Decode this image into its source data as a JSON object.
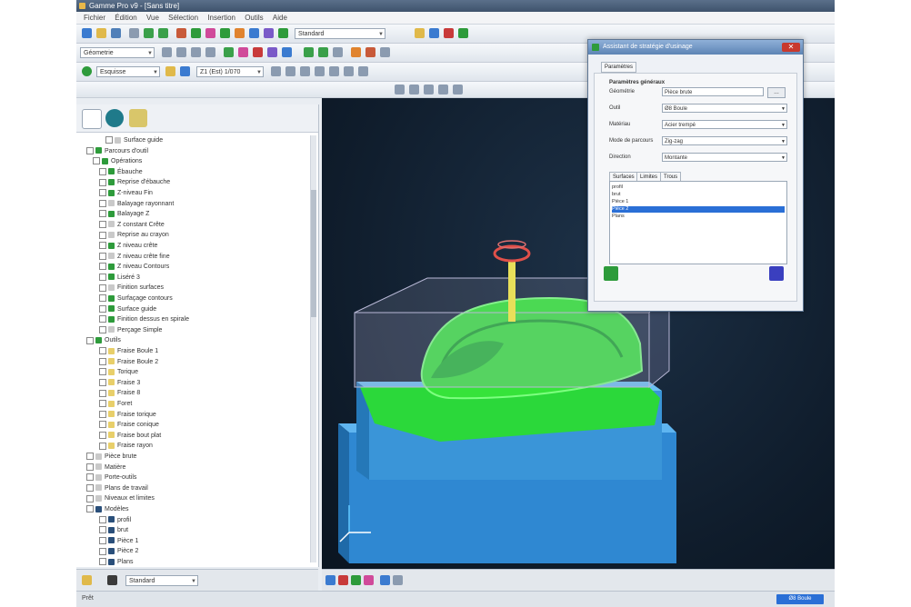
{
  "colors": {
    "viewport_bg": "#0f1c2b",
    "stock_block": "#2f88d2",
    "part_green": "#36e33a",
    "tool_holder": "#e0504a",
    "dialog_title": "#5d84b5",
    "list_selection": "#2a6fd6"
  },
  "window": {
    "title": "Gamme Pro v9 - [Sans titre]",
    "menu": [
      "Fichier",
      "Édition",
      "Vue",
      "Sélection",
      "Insertion",
      "Outils",
      "Aide"
    ]
  },
  "toolbar": {
    "combo1": "Géometrie",
    "combo2": "Standard",
    "combo3": "Z1 (Est) 1/070",
    "combo4": "Esquisse"
  },
  "tree": {
    "rows": [
      {
        "label": "Surface guide",
        "indent": 4,
        "icon": "#c9c9c9"
      },
      {
        "label": "Parcours d'outil",
        "indent": 1,
        "icon": "#2e9b3b"
      },
      {
        "label": "Opérations",
        "indent": 2,
        "icon": "#2e9b3b"
      },
      {
        "label": "Ébauche",
        "indent": 3,
        "icon": "#2e9b3b"
      },
      {
        "label": "Reprise d'ébauche",
        "indent": 3,
        "icon": "#2e9b3b"
      },
      {
        "label": "Z-niveau Fin",
        "indent": 3,
        "icon": "#2e9b3b"
      },
      {
        "label": "Balayage rayonnant",
        "indent": 3,
        "icon": "#c9c9c9"
      },
      {
        "label": "Balayage Z",
        "indent": 3,
        "icon": "#2e9b3b"
      },
      {
        "label": "Z constant Crête",
        "indent": 3,
        "icon": "#c9c9c9"
      },
      {
        "label": "Reprise au crayon",
        "indent": 3,
        "icon": "#c9c9c9"
      },
      {
        "label": "Z niveau crête",
        "indent": 3,
        "icon": "#2e9b3b"
      },
      {
        "label": "Z niveau crête fine",
        "indent": 3,
        "icon": "#c9c9c9"
      },
      {
        "label": "Z niveau Contours",
        "indent": 3,
        "icon": "#2e9b3b"
      },
      {
        "label": "Liséré 3",
        "indent": 3,
        "icon": "#2e9b3b"
      },
      {
        "label": "Finition surfaces",
        "indent": 3,
        "icon": "#c9c9c9"
      },
      {
        "label": "Surfaçage contours",
        "indent": 3,
        "icon": "#2e9b3b"
      },
      {
        "label": "Surface guide",
        "indent": 3,
        "icon": "#2e9b3b"
      },
      {
        "label": "Finition dessus en spirale",
        "indent": 3,
        "icon": "#2e9b3b"
      },
      {
        "label": "Perçage Simple",
        "indent": 3,
        "icon": "#c9c9c9"
      },
      {
        "label": "Outils",
        "indent": 1,
        "icon": "#2e9b3b"
      },
      {
        "label": "Fraise Boule 1",
        "indent": 3,
        "icon": "#e8cf6a"
      },
      {
        "label": "Fraise Boule 2",
        "indent": 3,
        "icon": "#e8cf6a"
      },
      {
        "label": "Torique",
        "indent": 3,
        "icon": "#e8cf6a"
      },
      {
        "label": "Fraise 3",
        "indent": 3,
        "icon": "#e8cf6a"
      },
      {
        "label": "Fraise 8",
        "indent": 3,
        "icon": "#e8cf6a"
      },
      {
        "label": "Foret",
        "indent": 3,
        "icon": "#e8cf6a"
      },
      {
        "label": "Fraise torique",
        "indent": 3,
        "icon": "#e8cf6a"
      },
      {
        "label": "Fraise conique",
        "indent": 3,
        "icon": "#e8cf6a"
      },
      {
        "label": "Fraise bout plat",
        "indent": 3,
        "icon": "#e8cf6a"
      },
      {
        "label": "Fraise rayon",
        "indent": 3,
        "icon": "#e8cf6a"
      },
      {
        "label": "Pièce brute",
        "indent": 1,
        "icon": "#c9c9c9"
      },
      {
        "label": "Matière",
        "indent": 1,
        "icon": "#c9c9c9"
      },
      {
        "label": "Porte-outils",
        "indent": 1,
        "icon": "#c9c9c9"
      },
      {
        "label": "Plans de travail",
        "indent": 1,
        "icon": "#c9c9c9"
      },
      {
        "label": "Niveaux et limites",
        "indent": 1,
        "icon": "#c9c9c9"
      },
      {
        "label": "Modèles",
        "indent": 1,
        "icon": "#2a4f7a"
      },
      {
        "label": "profil",
        "indent": 3,
        "icon": "#2a4f7a"
      },
      {
        "label": "brut",
        "indent": 3,
        "icon": "#2a4f7a"
      },
      {
        "label": "Pièce 1",
        "indent": 3,
        "icon": "#2a4f7a"
      },
      {
        "label": "Pièce 2",
        "indent": 3,
        "icon": "#2a4f7a"
      },
      {
        "label": "Plans",
        "indent": 3,
        "icon": "#2a4f7a"
      }
    ]
  },
  "dialog": {
    "title": "Assistant de stratégie d'usinage",
    "close": "✕",
    "tab_general": "Paramètres",
    "section_title": "Paramètres généraux",
    "label_geometry": "Géométrie",
    "geometry_value": "Pièce brute",
    "row_labels": [
      "Outil",
      "Matériau",
      "Mode de parcours",
      "Direction"
    ],
    "row_values": [
      "Ø8 Boule",
      "Acier trempé",
      "Zig-zag",
      "Montante"
    ],
    "list_tabs": [
      "Surfaces",
      "Limites",
      "Trous"
    ],
    "list_items": [
      "profil",
      "brut",
      "Pièce 1",
      "Pièce 2",
      "Plans"
    ],
    "selected_index": 3
  },
  "statusbar": {
    "text": "Prêt",
    "badge": "Ø8 Boule"
  }
}
